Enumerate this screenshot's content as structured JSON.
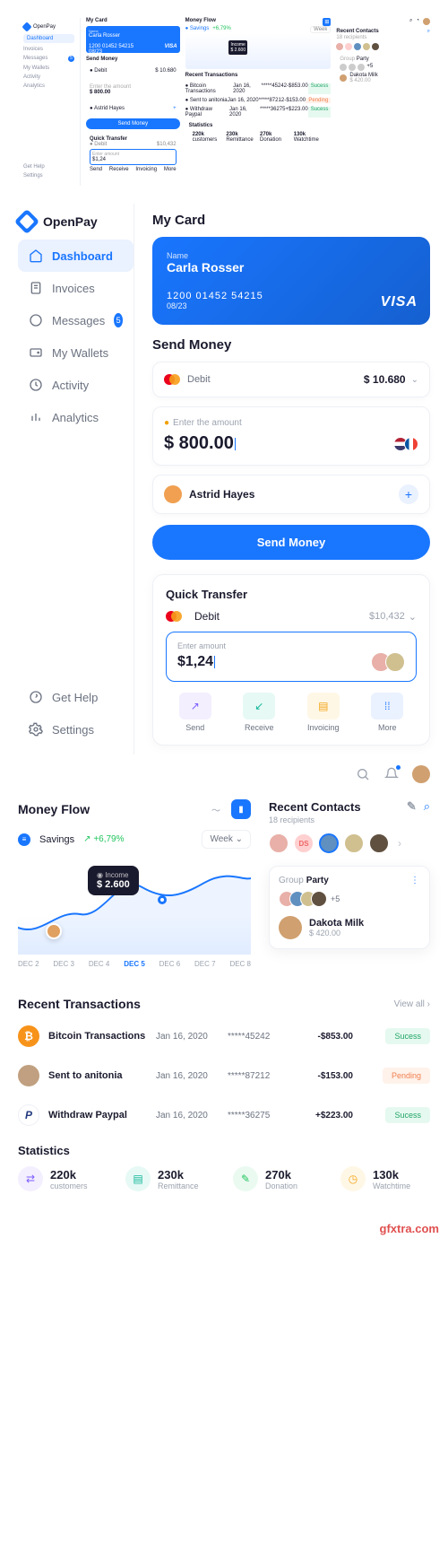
{
  "brand": "OpenPay",
  "nav": {
    "items": [
      {
        "label": "Dashboard",
        "active": true
      },
      {
        "label": "Invoices"
      },
      {
        "label": "Messages",
        "badge": "5"
      },
      {
        "label": "My Wallets"
      },
      {
        "label": "Activity"
      },
      {
        "label": "Analytics"
      }
    ],
    "help": "Get Help",
    "settings": "Settings"
  },
  "mycard": {
    "title": "My Card",
    "name_label": "Name",
    "name": "Carla Rosser",
    "number": "1200 01452 54215",
    "expiry": "08/23",
    "brand": "VISA"
  },
  "send": {
    "title": "Send Money",
    "method": "Debit",
    "balance": "$ 10.680",
    "hint": "Enter the amount",
    "amount": "$ 800.00",
    "recipient": "Astrid Hayes",
    "button": "Send Money"
  },
  "quick": {
    "title": "Quick Transfer",
    "method": "Debit",
    "balance": "$10,432",
    "placeholder": "Enter amount",
    "value": "$1,24",
    "actions": [
      {
        "label": "Send"
      },
      {
        "label": "Receive"
      },
      {
        "label": "Invoicing"
      },
      {
        "label": "More"
      }
    ]
  },
  "flow": {
    "title": "Money Flow",
    "series": "Savings",
    "change": "+6,79%",
    "range": "Week",
    "tooltip_label": "Income",
    "tooltip_value": "$ 2.600",
    "axis": [
      "DEC 2",
      "DEC 3",
      "DEC 4",
      "DEC 5",
      "DEC 6",
      "DEC 7",
      "DEC 8"
    ],
    "axis_active": "DEC 5"
  },
  "contacts": {
    "title": "Recent Contacts",
    "sub": "18 recipients",
    "initials": "DS",
    "group_label": "Group",
    "group_name": "Party",
    "extra": "+5",
    "person": "Dakota Milk",
    "amount": "$ 420.00"
  },
  "transactions": {
    "title": "Recent Transactions",
    "viewall": "View all",
    "rows": [
      {
        "name": "Bitcoin Transactions",
        "date": "Jan 16, 2020",
        "card": "*****45242",
        "amount": "-$853.00",
        "status": "Sucess",
        "cls": "s",
        "ico": "btc",
        "glyph": "₿"
      },
      {
        "name": "Sent to anitonia",
        "date": "Jan 16, 2020",
        "card": "*****87212",
        "amount": "-$153.00",
        "status": "Pending",
        "cls": "p",
        "ico": "usr",
        "glyph": ""
      },
      {
        "name": "Withdraw Paypal",
        "date": "Jan 16, 2020",
        "card": "*****36275",
        "amount": "+$223.00",
        "status": "Sucess",
        "cls": "s",
        "ico": "pp",
        "glyph": "P"
      }
    ]
  },
  "stats": {
    "title": "Statistics",
    "items": [
      {
        "value": "220k",
        "label": "customers",
        "cls": "purple",
        "glyph": "⇄"
      },
      {
        "value": "230k",
        "label": "Remittance",
        "cls": "teal",
        "glyph": "▤"
      },
      {
        "value": "270k",
        "label": "Donation",
        "cls": "green",
        "glyph": "✎"
      },
      {
        "value": "130k",
        "label": "Watchtime",
        "cls": "amber",
        "glyph": "◷"
      }
    ]
  },
  "footer": "gfxtra.com",
  "chart_data": {
    "type": "line",
    "title": "Money Flow",
    "series": [
      {
        "name": "Savings",
        "values": [
          1400,
          1200,
          2000,
          2600,
          2100,
          2500,
          2800
        ]
      }
    ],
    "categories": [
      "DEC 2",
      "DEC 3",
      "DEC 4",
      "DEC 5",
      "DEC 6",
      "DEC 7",
      "DEC 8"
    ],
    "ylabel": "Income",
    "highlight": {
      "x": "DEC 5",
      "value": 2600,
      "label": "$ 2.600"
    },
    "change_pct": 6.79
  }
}
